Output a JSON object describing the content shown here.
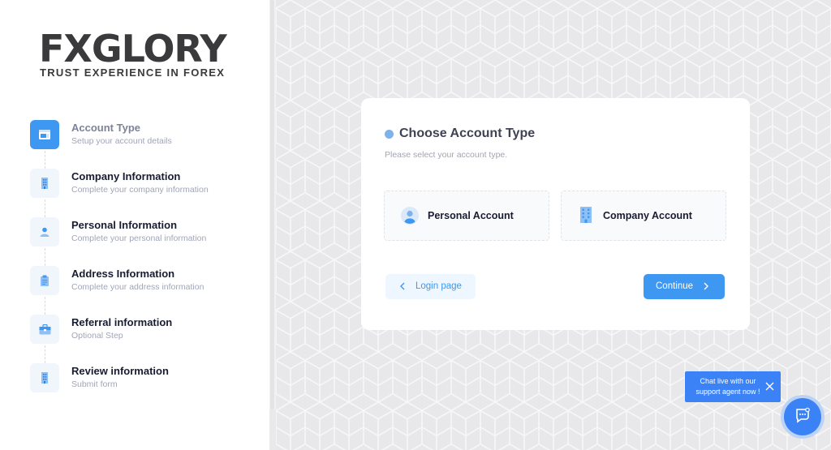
{
  "brand": {
    "logo_text": "FXGLORY",
    "tagline": "TRUST EXPERIENCE IN FOREX"
  },
  "steps": [
    {
      "title": "Account Type",
      "desc": "Setup your account details",
      "icon": "layout-icon",
      "active": true
    },
    {
      "title": "Company Information",
      "desc": "Complete your company information",
      "icon": "building-icon",
      "active": false
    },
    {
      "title": "Personal Information",
      "desc": "Complete your personal information",
      "icon": "user-icon",
      "active": false
    },
    {
      "title": "Address Information",
      "desc": "Complete your address information",
      "icon": "clipboard-icon",
      "active": false
    },
    {
      "title": "Referral information",
      "desc": "Optional Step",
      "icon": "briefcase-icon",
      "active": false
    },
    {
      "title": "Review information",
      "desc": "Submit form",
      "icon": "building-icon",
      "active": false
    }
  ],
  "form": {
    "heading": "Choose Account Type",
    "subheading": "Please select your account type.",
    "options": [
      {
        "label": "Personal Account",
        "icon": "user-avatar-icon"
      },
      {
        "label": "Company Account",
        "icon": "building-icon"
      }
    ],
    "back_label": "Login page",
    "continue_label": "Continue"
  },
  "chat": {
    "tooltip": "Chat live with our support agent now !"
  },
  "colors": {
    "accent": "#3e97f0",
    "accent_light": "#f1f6fd",
    "text_dark": "#181c32",
    "text_muted": "#a1a5b7"
  }
}
